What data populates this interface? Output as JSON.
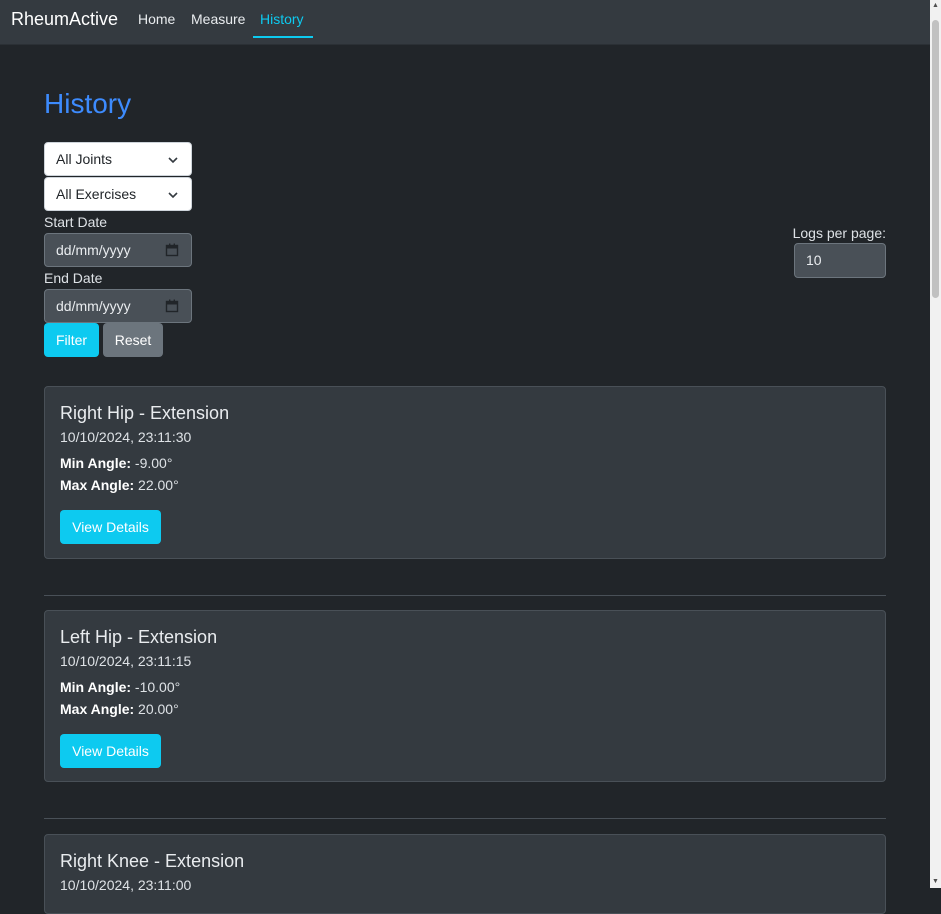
{
  "nav": {
    "brand": "RheumActive",
    "links": [
      {
        "label": "Home"
      },
      {
        "label": "Measure"
      },
      {
        "label": "History"
      }
    ]
  },
  "page": {
    "title": "History"
  },
  "filters": {
    "joint_select": "All Joints",
    "exercise_select": "All Exercises",
    "start_date_label": "Start Date",
    "start_date_placeholder": "dd/mm/yyyy",
    "end_date_label": "End Date",
    "end_date_placeholder": "dd/mm/yyyy",
    "filter_button": "Filter",
    "reset_button": "Reset",
    "logs_per_page_label": "Logs per page:",
    "logs_per_page_value": "10"
  },
  "logs": [
    {
      "title": "Right Hip - Extension",
      "date": "10/10/2024, 23:11:30",
      "min_label": "Min Angle:",
      "min_value": "-9.00°",
      "max_label": "Max Angle:",
      "max_value": "22.00°",
      "button": "View Details"
    },
    {
      "title": "Left Hip - Extension",
      "date": "10/10/2024, 23:11:15",
      "min_label": "Min Angle:",
      "min_value": "-10.00°",
      "max_label": "Max Angle:",
      "max_value": "20.00°",
      "button": "View Details"
    },
    {
      "title": "Right Knee - Extension",
      "date": "10/10/2024, 23:11:00"
    }
  ],
  "colors": {
    "accent": "#0dcaf0",
    "title": "#3d8bfd",
    "background": "#212529",
    "card": "#343a40"
  }
}
